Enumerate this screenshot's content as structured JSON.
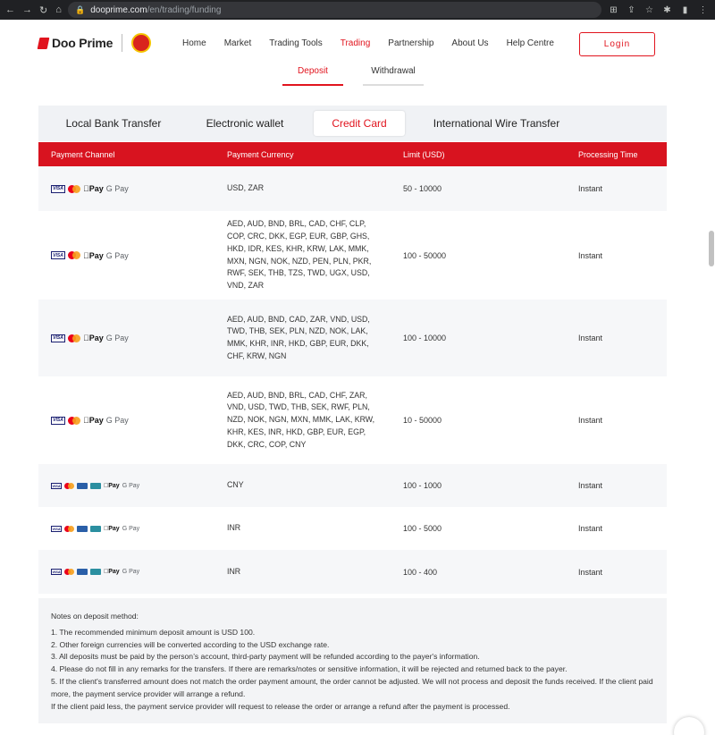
{
  "browser": {
    "url_host": "dooprime.com",
    "url_path": "/en/trading/funding"
  },
  "header": {
    "brand": "Doo Prime",
    "nav": [
      "Home",
      "Market",
      "Trading Tools",
      "Trading",
      "Partnership",
      "About Us",
      "Help Centre"
    ],
    "login_label": "Login",
    "accent": "#e1141e"
  },
  "subnav": {
    "deposit": "Deposit",
    "withdrawal": "Withdrawal"
  },
  "methods": [
    "Local Bank Transfer",
    "Electronic wallet",
    "Credit Card",
    "International Wire Transfer"
  ],
  "table": {
    "headers": [
      "Payment Channel",
      "Payment Currency",
      "Limit (USD)",
      "Processing Time"
    ],
    "rows": [
      {
        "currency": "USD, ZAR",
        "limit": "50 - 10000",
        "time": "Instant"
      },
      {
        "currency": "AED, AUD, BND, BRL, CAD, CHF, CLP, COP, CRC, DKK, EGP, EUR, GBP, GHS, HKD, IDR, KES, KHR, KRW, LAK, MMK, MXN, NGN, NOK, NZD, PEN, PLN, PKR, RWF, SEK, THB, TZS, TWD, UGX, USD, VND, ZAR",
        "limit": "100 - 50000",
        "time": "Instant"
      },
      {
        "currency": "AED, AUD, BND, CAD, ZAR, VND, USD, TWD, THB, SEK, PLN, NZD, NOK, LAK, MMK, KHR, INR, HKD, GBP, EUR, DKK, CHF, KRW, NGN",
        "limit": "100 - 10000",
        "time": "Instant"
      },
      {
        "currency": "AED, AUD, BND, BRL, CAD, CHF, ZAR, VND, USD, TWD, THB, SEK, RWF, PLN, NZD, NOK, NGN, MXN, MMK, LAK, KRW, KHR, KES, INR, HKD, GBP, EUR, EGP, DKK, CRC, COP, CNY",
        "limit": "10 - 50000",
        "time": "Instant"
      },
      {
        "currency": "CNY",
        "limit": "100 - 1000",
        "time": "Instant"
      },
      {
        "currency": "INR",
        "limit": "100 - 5000",
        "time": "Instant"
      },
      {
        "currency": "INR",
        "limit": "100 - 400",
        "time": "Instant"
      }
    ]
  },
  "icons": {
    "visa": "VISA",
    "apple_pay": "Pay",
    "google_pay": "G Pay"
  },
  "notes": {
    "title": "Notes on deposit method:",
    "lines": [
      "1. The recommended minimum deposit amount is USD 100.",
      "2. Other foreign currencies will be converted according to the USD exchange rate.",
      "3. All deposits must be paid by the person’s account, third-party payment will be refunded according to the payer's information.",
      "4. Please do not fill in any remarks for the transfers. If there are remarks/notes or sensitive information, it will be rejected and returned back to the payer.",
      "5. If the client's transferred amount does not match the order payment amount, the order cannot be adjusted. We will not process and deposit the funds received. If the client paid more, the payment service provider will arrange a refund.",
      "If the client paid less, the payment service provider will request to release the order or arrange a refund after the payment is processed."
    ]
  }
}
